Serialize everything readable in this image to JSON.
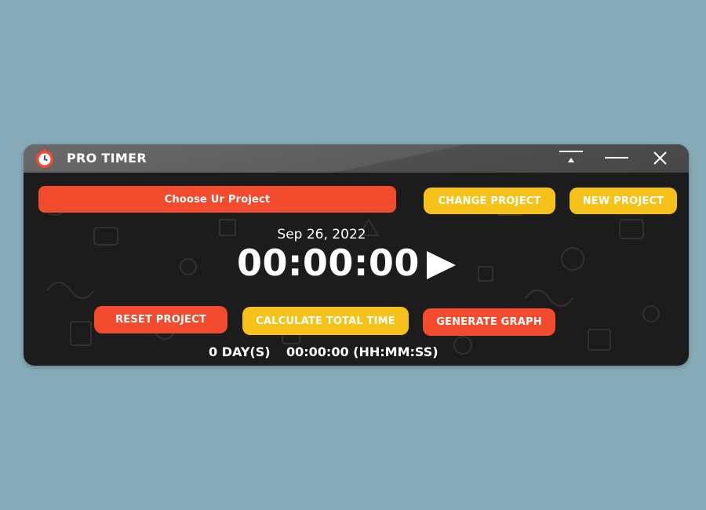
{
  "window": {
    "title": "PRO TIMER",
    "icon": "stopwatch-icon",
    "controls": {
      "pin": "pin-top-icon",
      "minimize": "minimize-icon",
      "close": "close-icon"
    }
  },
  "project": {
    "selector_label": "Choose Ur Project"
  },
  "buttons": {
    "change_project": "CHANGE PROJECT",
    "new_project": "NEW PROJECT",
    "reset_project": "RESET PROJECT",
    "calculate_total_time": "CALCULATE TOTAL TIME",
    "generate_graph": "GENERATE GRAPH"
  },
  "timer": {
    "date": "Sep 26, 2022",
    "elapsed": "00:00:00",
    "play_icon": "play-icon"
  },
  "summary": {
    "days": "0 DAY(S)",
    "total_time": "00:00:00 (HH:MM:SS)"
  },
  "colors": {
    "desktop_background": "#86aab8",
    "window_background": "#1c1c1c",
    "titlebar": "#5d5d5d",
    "accent_red": "#f24b2e",
    "accent_yellow": "#f6c21a",
    "text": "#ffffff"
  }
}
